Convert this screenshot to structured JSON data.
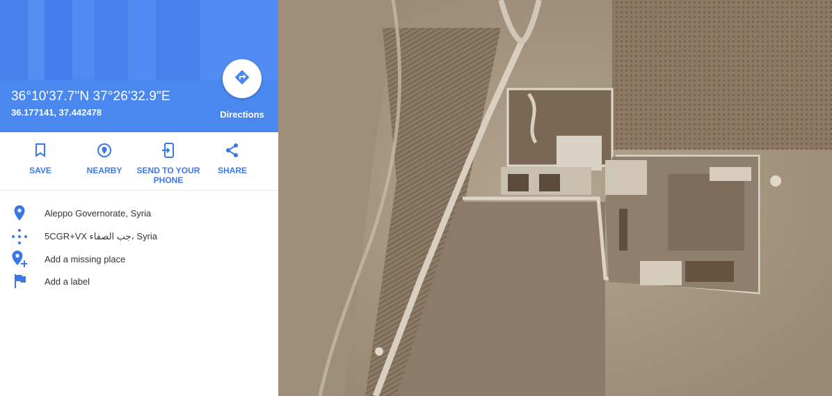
{
  "place": {
    "coords_dms": "36°10'37.7\"N 37°26'32.9\"E",
    "coords_decimal": "36.177141, 37.442478"
  },
  "directions": {
    "label": "Directions",
    "icon": "directions-icon"
  },
  "actions": [
    {
      "label": "SAVE",
      "icon": "bookmark-icon"
    },
    {
      "label": "NEARBY",
      "icon": "nearby-icon"
    },
    {
      "label": "SEND TO YOUR PHONE",
      "icon": "send-to-phone-icon"
    },
    {
      "label": "SHARE",
      "icon": "share-icon"
    }
  ],
  "info": [
    {
      "text": "Aleppo Governorate, Syria",
      "icon": "location-pin-icon"
    },
    {
      "text": "5CGR+VX جب الصفاء، Syria",
      "icon": "plus-code-icon"
    },
    {
      "text": "Add a missing place",
      "icon": "add-place-icon"
    },
    {
      "text": "Add a label",
      "icon": "flag-icon"
    }
  ],
  "colors": {
    "accent": "#4a88f0",
    "action": "#3b78e7",
    "map_base": "#a39480"
  }
}
